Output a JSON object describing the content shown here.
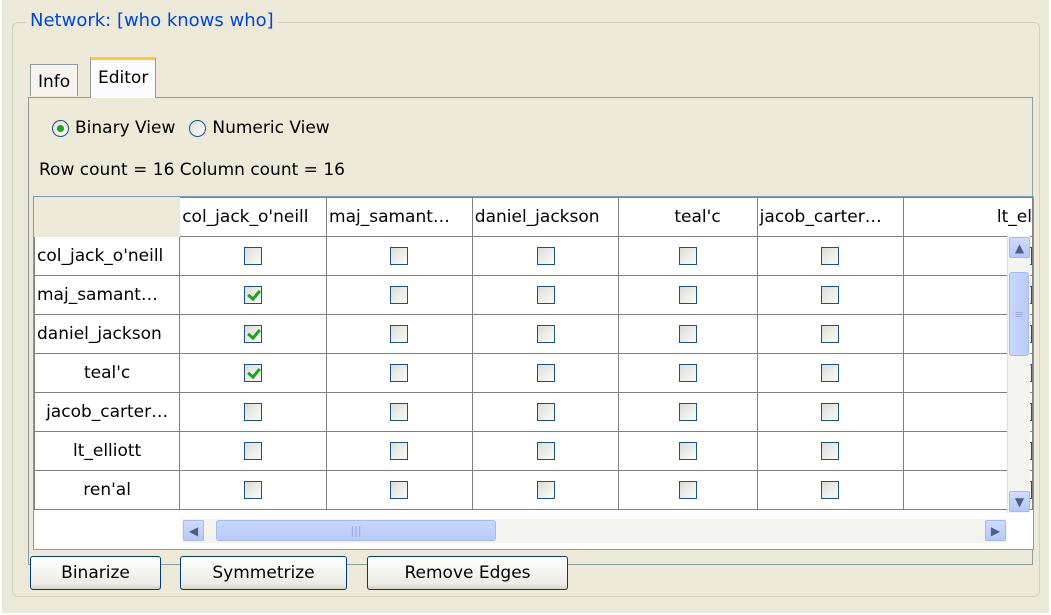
{
  "group": {
    "title": "Network: [who knows who]"
  },
  "tabs": [
    {
      "label": "Info",
      "selected": false
    },
    {
      "label": "Editor",
      "selected": true
    }
  ],
  "view_mode": {
    "options": [
      {
        "label": "Binary View",
        "selected": true
      },
      {
        "label": "Numeric View",
        "selected": false
      }
    ]
  },
  "counts_text": "Row count = 16 Column count = 16",
  "matrix": {
    "columns": [
      "col_jack_o'neill",
      "maj_samant…",
      "daniel_jackson",
      "teal'c",
      "jacob_carter…",
      "lt_el"
    ],
    "rows": [
      {
        "label": "col_jack_o'neill",
        "checked": [
          false,
          false,
          false,
          false,
          false,
          false
        ]
      },
      {
        "label": "maj_samant…",
        "checked": [
          true,
          false,
          false,
          false,
          false,
          false
        ]
      },
      {
        "label": "daniel_jackson",
        "checked": [
          true,
          false,
          false,
          false,
          false,
          false
        ]
      },
      {
        "label": "teal'c",
        "checked": [
          true,
          false,
          false,
          false,
          false,
          false
        ]
      },
      {
        "label": "jacob_carter…",
        "checked": [
          false,
          false,
          false,
          false,
          false,
          false
        ]
      },
      {
        "label": "lt_elliott",
        "checked": [
          false,
          false,
          false,
          false,
          false,
          false
        ]
      },
      {
        "label": "ren'al",
        "checked": [
          false,
          false,
          false,
          false,
          false,
          false
        ]
      }
    ]
  },
  "buttons": {
    "binarize": "Binarize",
    "symmetrize": "Symmetrize",
    "remove_edges": "Remove Edges"
  },
  "colors": {
    "group_title": "#0046d5",
    "tab_highlight": "#ffc83c",
    "check_mark": "#21a121",
    "scroll_button": "#b6c8f8"
  }
}
